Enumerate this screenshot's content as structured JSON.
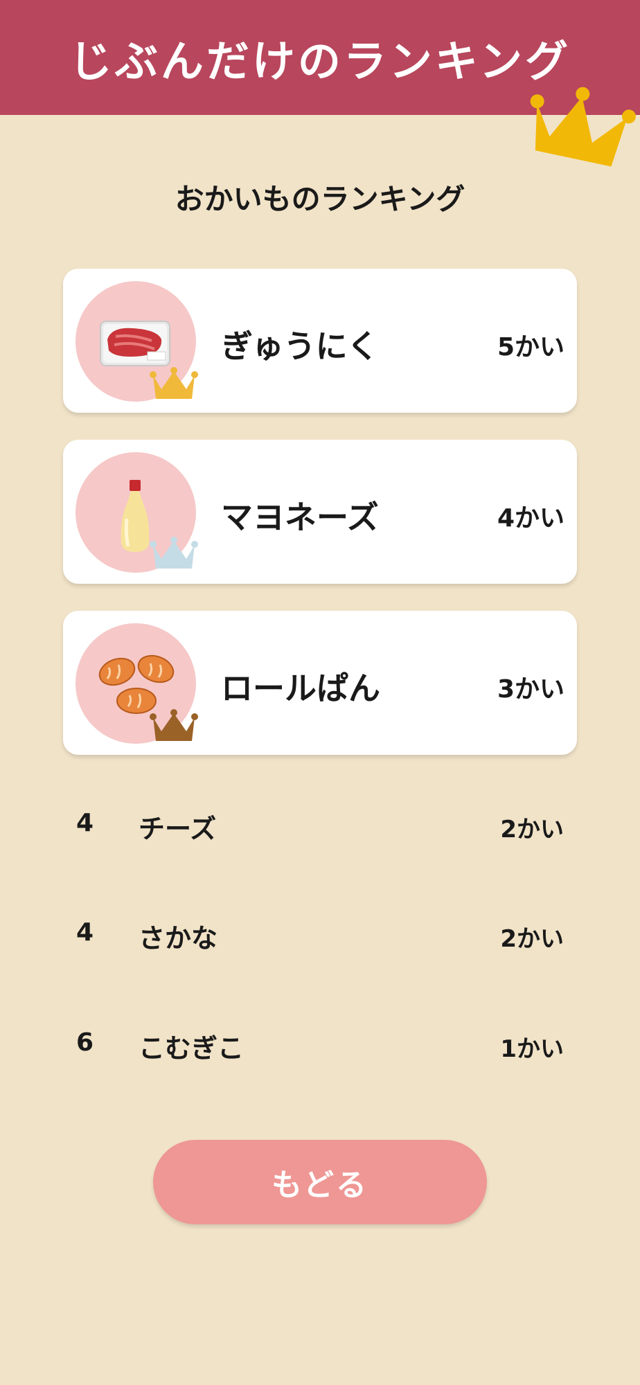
{
  "header": {
    "title": "じぶんだけのランキング",
    "crown_icon": "crown-icon",
    "color": "#b8465c"
  },
  "page_title": "おかいものランキング",
  "top_items": [
    {
      "name": "ぎゅうにく",
      "count": "5かい",
      "icon": "beef-icon",
      "crown": "gold-crown-icon",
      "crown_color": "#f0b93a"
    },
    {
      "name": "マヨネーズ",
      "count": "4かい",
      "icon": "mayonnaise-icon",
      "crown": "silver-crown-icon",
      "crown_color": "#c4dce6"
    },
    {
      "name": "ロールぱん",
      "count": "3かい",
      "icon": "roll-bread-icon",
      "crown": "bronze-crown-icon",
      "crown_color": "#9a6227"
    }
  ],
  "other_items": [
    {
      "rank": "4",
      "name": "チーズ",
      "count": "2かい"
    },
    {
      "rank": "4",
      "name": "さかな",
      "count": "2かい"
    },
    {
      "rank": "6",
      "name": "こむぎこ",
      "count": "1かい"
    }
  ],
  "back_button": {
    "label": "もどる"
  }
}
